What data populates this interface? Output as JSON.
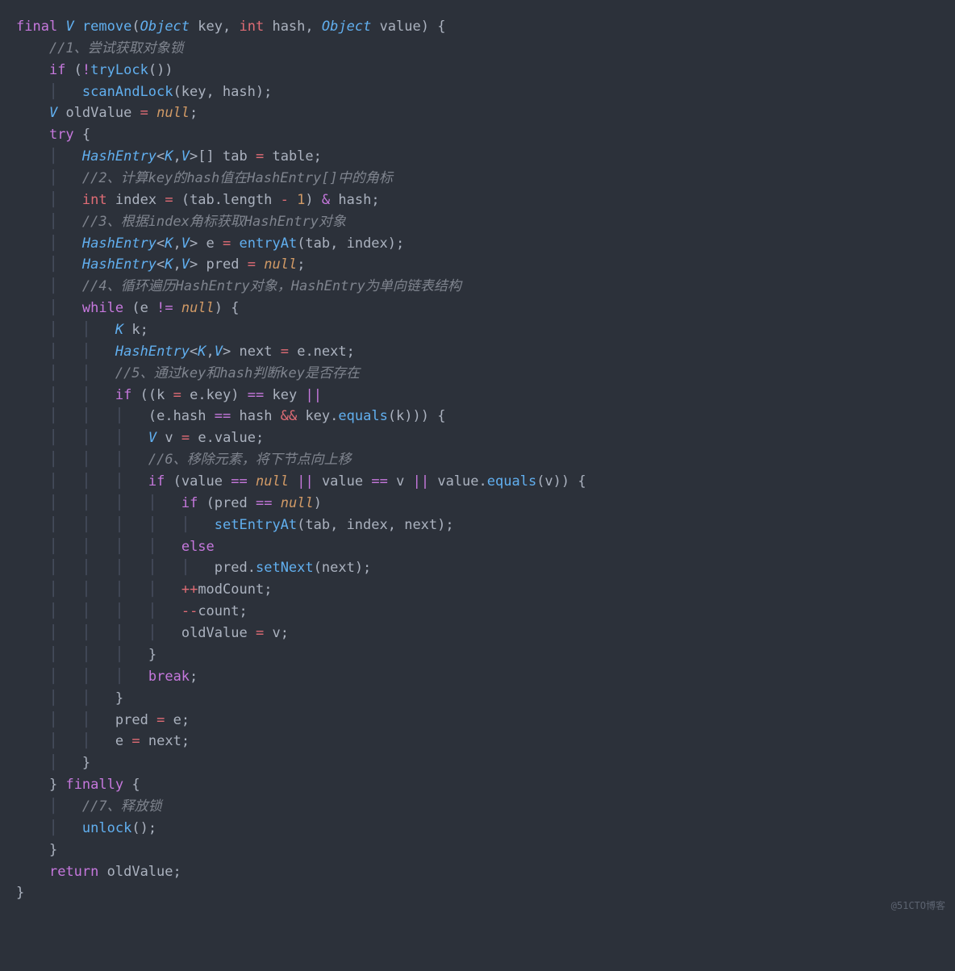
{
  "watermark": "@51CTO博客",
  "code": {
    "l1": {
      "a": "final",
      "b": "V",
      "c": "remove",
      "d": "Object",
      "e": "key",
      "f": "int",
      "g": "hash",
      "h": "Object",
      "i": "value"
    },
    "l2": "//1、尝试获取对象锁",
    "l3": {
      "a": "if",
      "b": "!",
      "c": "tryLock"
    },
    "l4": {
      "a": "scanAndLock",
      "b": "(key, hash);"
    },
    "l5": {
      "a": "V",
      "b": "oldValue",
      "c": "=",
      "d": "null"
    },
    "l6": {
      "a": "try"
    },
    "l7": {
      "a": "HashEntry",
      "b": "K",
      "c": "V",
      "d": "[] tab",
      "e": "=",
      "f": "table;"
    },
    "l8": "//2、计算key的hash值在HashEntry[]中的角标",
    "l9": {
      "a": "int",
      "b": "index",
      "c": "=",
      "d": "(tab.length",
      "e": "-",
      "f": "1",
      "g": ")",
      "h": "&",
      "i": "hash;"
    },
    "l10": "//3、根据index角标获取HashEntry对象",
    "l11": {
      "a": "HashEntry",
      "b": "K",
      "c": "V",
      "d": "e",
      "e": "=",
      "f": "entryAt",
      "g": "(tab, index);"
    },
    "l12": {
      "a": "HashEntry",
      "b": "K",
      "c": "V",
      "d": "pred",
      "e": "=",
      "f": "null"
    },
    "l13": "//4、循环遍历HashEntry对象，HashEntry为单向链表结构",
    "l14": {
      "a": "while",
      "b": "(e",
      "c": "!=",
      "d": "null",
      "e": ") {"
    },
    "l15": {
      "a": "K",
      "b": "k;"
    },
    "l16": {
      "a": "HashEntry",
      "b": "K",
      "c": "V",
      "d": "next",
      "e": "=",
      "f": "e.next;"
    },
    "l17": "//5、通过key和hash判断key是否存在",
    "l18": {
      "a": "if",
      "b": "((k",
      "c": "=",
      "d": "e.key)",
      "e": "==",
      "f": "key",
      "g": "||"
    },
    "l19": {
      "a": "(e.hash",
      "b": "==",
      "c": "hash",
      "d": "&&",
      "e": "key.",
      "f": "equals",
      "g": "(k))) {"
    },
    "l20": {
      "a": "V",
      "b": "v",
      "c": "=",
      "d": "e.value;"
    },
    "l21": "//6、移除元素，将下节点向上移",
    "l22": {
      "a": "if",
      "b": "(value",
      "c": "==",
      "d": "null",
      "e": "||",
      "f": "value",
      "g": "==",
      "h": "v",
      "i": "||",
      "j": "value.",
      "k": "equals",
      "l": "(v)) {"
    },
    "l23": {
      "a": "if",
      "b": "(pred",
      "c": "==",
      "d": "null",
      "e": ")"
    },
    "l24": {
      "a": "setEntryAt",
      "b": "(tab, index, next);"
    },
    "l25": {
      "a": "else"
    },
    "l26": {
      "a": "pred.",
      "b": "setNext",
      "c": "(next);"
    },
    "l27": {
      "a": "++",
      "b": "modCount;"
    },
    "l28": {
      "a": "--",
      "b": "count;"
    },
    "l29": {
      "a": "oldValue",
      "b": "=",
      "c": "v;"
    },
    "l30": "}",
    "l31": {
      "a": "break",
      "b": ";"
    },
    "l32": "}",
    "l33": {
      "a": "pred",
      "b": "=",
      "c": "e;"
    },
    "l34": {
      "a": "e",
      "b": "=",
      "c": "next;"
    },
    "l35": "}",
    "l36": {
      "a": "}",
      "b": "finally",
      "c": "{"
    },
    "l37": "//7、释放锁",
    "l38": {
      "a": "unlock",
      "b": "();"
    },
    "l39": "}",
    "l40": {
      "a": "return",
      "b": "oldValue;"
    },
    "l41": "}"
  }
}
